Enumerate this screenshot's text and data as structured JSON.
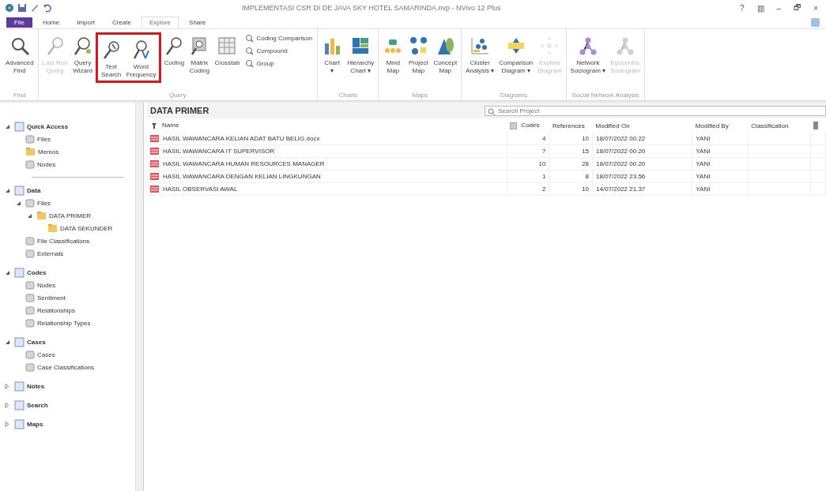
{
  "window": {
    "title": "IMPLEMENTASI CSR DI DE JAVA SKY HOTEL SAMARINDA.nvp - NVivo 12 Plus",
    "controls": [
      "?",
      "▥",
      "–",
      "🗗",
      "×"
    ]
  },
  "tabs": [
    {
      "label": "File",
      "selected": false,
      "kind": "file"
    },
    {
      "label": "Home",
      "selected": false,
      "kind": "tab"
    },
    {
      "label": "Import",
      "selected": false,
      "kind": "tab"
    },
    {
      "label": "Create",
      "selected": false,
      "kind": "tab"
    },
    {
      "label": "Explore",
      "selected": true,
      "kind": "tab"
    },
    {
      "label": "Share",
      "selected": false,
      "kind": "tab"
    }
  ],
  "ribbon": {
    "groups": [
      {
        "label": "Find",
        "items": [
          {
            "kind": "large",
            "lines": [
              "Advanced",
              "Find"
            ],
            "disabled": false
          }
        ]
      },
      {
        "label": "Query",
        "items": [
          {
            "kind": "large",
            "lines": [
              "Last Run",
              "Query"
            ],
            "disabled": true
          },
          {
            "kind": "large",
            "lines": [
              "Query",
              "Wizard"
            ],
            "disabled": false
          },
          {
            "kind": "highlight",
            "items": [
              {
                "kind": "large",
                "lines": [
                  "Text",
                  "Search"
                ],
                "disabled": false
              },
              {
                "kind": "large",
                "lines": [
                  "Word",
                  "Frequency"
                ],
                "disabled": false
              }
            ]
          },
          {
            "kind": "large",
            "lines": [
              "Coding"
            ],
            "disabled": false
          },
          {
            "kind": "large",
            "lines": [
              "Matrix",
              "Coding"
            ],
            "disabled": false
          },
          {
            "kind": "large",
            "lines": [
              "Crosstab"
            ],
            "disabled": false
          },
          {
            "kind": "stack",
            "items": [
              {
                "label": "Coding Comparison"
              },
              {
                "label": "Compound"
              },
              {
                "label": "Group"
              }
            ]
          }
        ]
      },
      {
        "label": "Charts",
        "items": [
          {
            "kind": "large",
            "lines": [
              "Chart",
              "▾"
            ],
            "disabled": false
          },
          {
            "kind": "large",
            "lines": [
              "Hierarchy",
              "Chart ▾"
            ],
            "disabled": false
          }
        ]
      },
      {
        "label": "Maps",
        "items": [
          {
            "kind": "large",
            "lines": [
              "Mind",
              "Map"
            ],
            "disabled": false
          },
          {
            "kind": "large",
            "lines": [
              "Project",
              "Map"
            ],
            "disabled": false
          },
          {
            "kind": "large",
            "lines": [
              "Concept",
              "Map"
            ],
            "disabled": false
          }
        ]
      },
      {
        "label": "Diagrams",
        "items": [
          {
            "kind": "large",
            "lines": [
              "Cluster",
              "Analysis ▾"
            ],
            "disabled": false
          },
          {
            "kind": "large",
            "lines": [
              "Comparison",
              "Diagram ▾"
            ],
            "disabled": false
          },
          {
            "kind": "large",
            "lines": [
              "Explore",
              "Diagram"
            ],
            "disabled": true
          }
        ]
      },
      {
        "label": "Social Network Analysis",
        "items": [
          {
            "kind": "large",
            "lines": [
              "Network",
              "Sociogram ▾"
            ],
            "disabled": false
          },
          {
            "kind": "large",
            "lines": [
              "Egocentric",
              "Sociogram"
            ],
            "disabled": true
          }
        ]
      }
    ]
  },
  "navigation": [
    {
      "label": "Quick Access",
      "kind": "section",
      "expanded": true,
      "children": [
        {
          "label": "Files",
          "kind": "item"
        },
        {
          "label": "Memos",
          "kind": "folder"
        },
        {
          "label": "Nodes",
          "kind": "item"
        }
      ]
    },
    {
      "kind": "separator"
    },
    {
      "label": "Data",
      "kind": "section",
      "expanded": true,
      "children": [
        {
          "label": "Files",
          "kind": "item",
          "expanded": true,
          "children": [
            {
              "label": "DATA PRIMER",
              "kind": "folder",
              "expanded": true,
              "children": [
                {
                  "label": "DATA SEKUNDER",
                  "kind": "folder"
                }
              ]
            }
          ]
        },
        {
          "label": "File Classifications",
          "kind": "item"
        },
        {
          "label": "Externals",
          "kind": "item"
        }
      ]
    },
    {
      "label": "Codes",
      "kind": "section",
      "expanded": true,
      "children": [
        {
          "label": "Nodes",
          "kind": "item"
        },
        {
          "label": "Sentiment",
          "kind": "item"
        },
        {
          "label": "Relationships",
          "kind": "item"
        },
        {
          "label": "Relationship Types",
          "kind": "item"
        }
      ]
    },
    {
      "label": "Cases",
      "kind": "section",
      "expanded": true,
      "children": [
        {
          "label": "Cases",
          "kind": "item"
        },
        {
          "label": "Case Classifications",
          "kind": "item"
        }
      ]
    },
    {
      "label": "Notes",
      "kind": "section",
      "expanded": false
    },
    {
      "label": "Search",
      "kind": "section",
      "expanded": false
    },
    {
      "label": "Maps",
      "kind": "section",
      "expanded": false
    }
  ],
  "list_view": {
    "title": "DATA PRIMER",
    "search": {
      "placeholder": "Search Project"
    },
    "columns": [
      "Name",
      "Codes",
      "References",
      "Modified On",
      "Modified By",
      "Classification"
    ],
    "rows": [
      [
        "HASIL WAWANCARA KELIAN ADAT BATU BELIG.docx",
        "4",
        "10",
        "18/07/2022 00.22",
        "YANI",
        ""
      ],
      [
        "HASIL WAWANCARA IT SUPERVISOR",
        "7",
        "15",
        "18/07/2022 00.20",
        "YANI",
        ""
      ],
      [
        "HASIL WAWANCARA HUMAN RESOURCES MANAGER",
        "10",
        "28",
        "18/07/2022 00.20",
        "YANI",
        ""
      ],
      [
        "HASIL WAWANCARA DENGAN KELIAN LINGKUNGAN",
        "1",
        "8",
        "18/07/2022 23.56",
        "YANI",
        ""
      ],
      [
        "HASIL OBSERVASI AWAL",
        "2",
        "10",
        "14/07/2022 21.37",
        "YANI",
        ""
      ]
    ]
  }
}
